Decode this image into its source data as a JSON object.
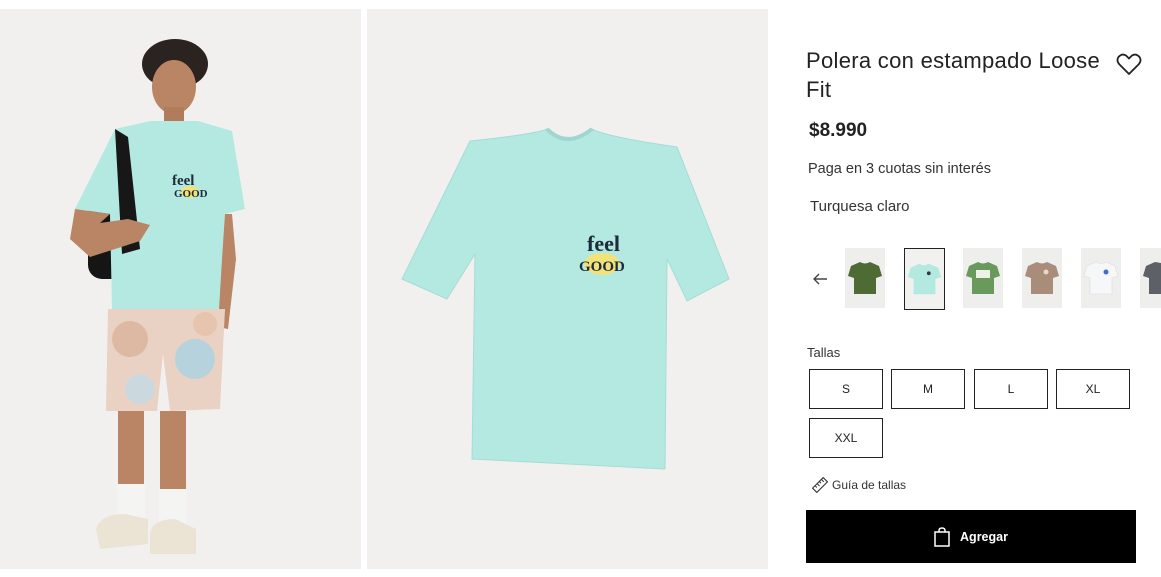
{
  "product": {
    "title": "Polera con estampado Loose Fit",
    "price": "$8.990",
    "installments": "Paga en 3 cuotas sin interés",
    "color_name": "Turquesa claro",
    "print_text": "feel GOOD"
  },
  "colors": {
    "tee": "#b4e9e2",
    "accent": "#000000"
  },
  "swatches": [
    {
      "name": "green",
      "color": "#4e6b36"
    },
    {
      "name": "turquesa claro",
      "color": "#b4e9e2",
      "selected": true
    },
    {
      "name": "green-print",
      "color": "#6a9a5b"
    },
    {
      "name": "brown",
      "color": "#a98c7a"
    },
    {
      "name": "white",
      "color": "#f6f7f8"
    },
    {
      "name": "grey",
      "color": "#5e6068"
    }
  ],
  "sizes": {
    "label": "Tallas",
    "options": [
      "S",
      "M",
      "L",
      "XL",
      "XXL"
    ]
  },
  "size_guide": "Guía de tallas",
  "add_to_cart": "Agregar"
}
